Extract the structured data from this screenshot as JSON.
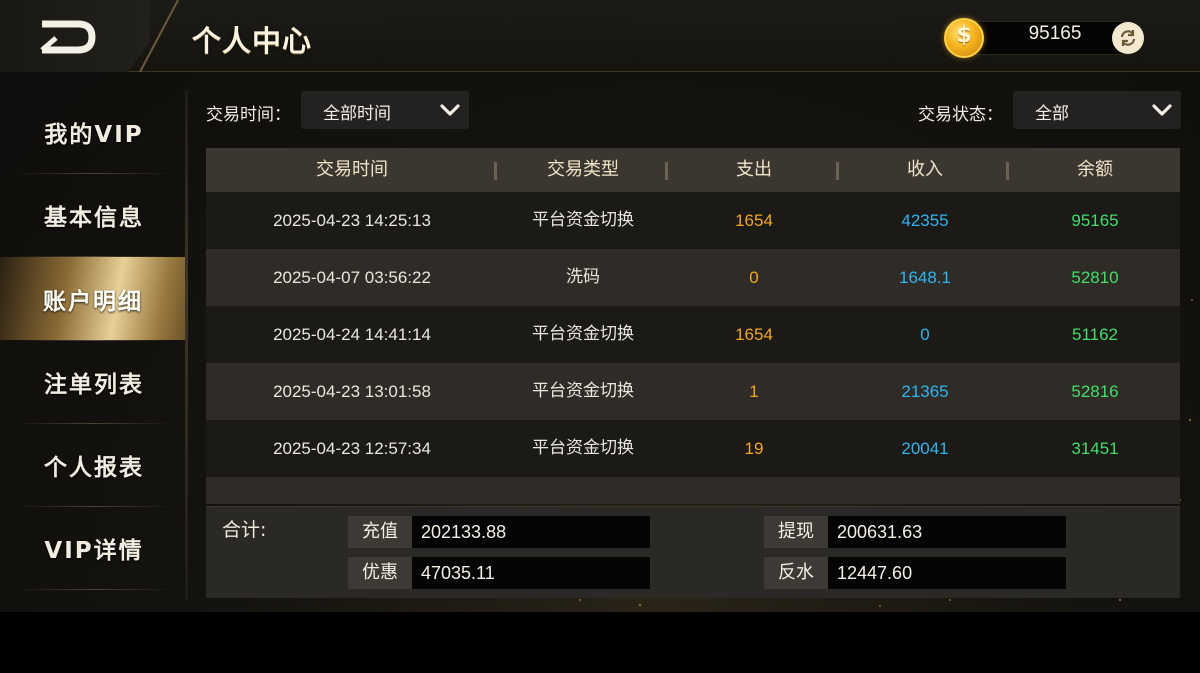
{
  "header": {
    "title": "个人中心",
    "balance": "95165",
    "coin_symbol": "$"
  },
  "sidebar": {
    "items": [
      {
        "label": "我的VIP",
        "active": false
      },
      {
        "label": "基本信息",
        "active": false
      },
      {
        "label": "账户明细",
        "active": true
      },
      {
        "label": "注单列表",
        "active": false
      },
      {
        "label": "个人报表",
        "active": false
      },
      {
        "label": "VIP详情",
        "active": false
      }
    ]
  },
  "filters": {
    "time_label": "交易时间：",
    "time_value": "全部时间",
    "status_label": "交易状态：",
    "status_value": "全部"
  },
  "table": {
    "columns": [
      "交易时间",
      "交易类型",
      "支出",
      "收入",
      "余额"
    ],
    "rows": [
      {
        "time": "2025-04-23 14:25:13",
        "type": "平台资金切换",
        "out": "1654",
        "in": "42355",
        "balance": "95165"
      },
      {
        "time": "2025-04-07 03:56:22",
        "type": "洗码",
        "out": "0",
        "in": "1648.1",
        "balance": "52810"
      },
      {
        "time": "2025-04-24 14:41:14",
        "type": "平台资金切换",
        "out": "1654",
        "in": "0",
        "balance": "51162"
      },
      {
        "time": "2025-04-23 13:01:58",
        "type": "平台资金切换",
        "out": "1",
        "in": "21365",
        "balance": "52816"
      },
      {
        "time": "2025-04-23 12:57:34",
        "type": "平台资金切换",
        "out": "19",
        "in": "20041",
        "balance": "31451"
      }
    ]
  },
  "totals": {
    "title": "合计:",
    "recharge_label": "充值",
    "recharge_value": "202133.88",
    "withdraw_label": "提现",
    "withdraw_value": "200631.63",
    "bonus_label": "优惠",
    "bonus_value": "47035.11",
    "rebate_label": "反水",
    "rebate_value": "12447.60"
  },
  "colors": {
    "expense": "#f4a623",
    "income": "#2fb4f2",
    "balance": "#43dd6b",
    "accent_gold": "#e8cf98"
  }
}
